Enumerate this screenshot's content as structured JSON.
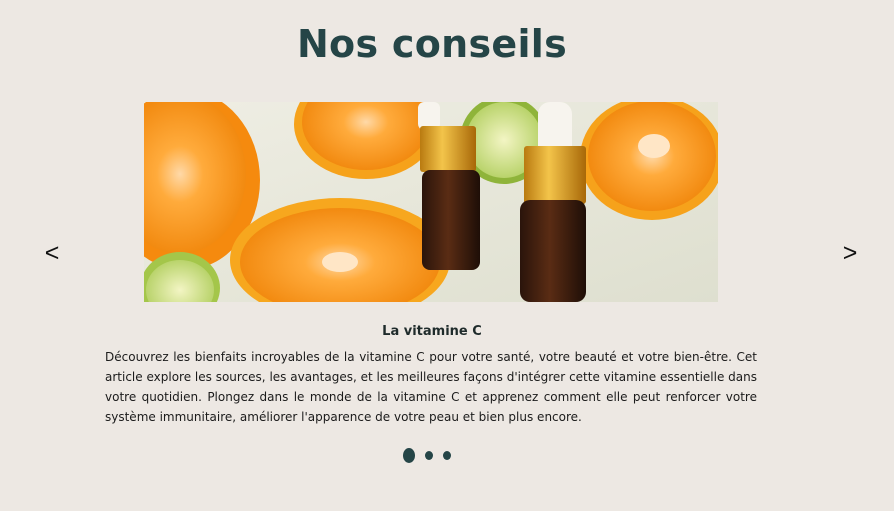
{
  "section": {
    "title": "Nos conseils"
  },
  "carousel": {
    "prev_label": "<",
    "next_label": ">",
    "slide": {
      "title": "La vitamine C",
      "text": "Découvrez les bienfaits incroyables de la vitamine C pour votre santé, votre beauté et votre bien-être. Cet article explore les sources, les avantages, et les meilleures façons d'intégrer cette vitamine essentielle dans votre quotidien. Plongez dans le monde de la vitamine C et apprenez comment elle peut renforcer votre système immunitaire, améliorer l'apparence de votre peau et bien plus encore.",
      "image": "photo of halved oranges, limes and two amber dropper bottles of serum"
    },
    "dots": {
      "count": 3,
      "active_index": 0
    }
  },
  "colors": {
    "background": "#ede8e3",
    "heading": "#254547",
    "dots": "#254547"
  }
}
